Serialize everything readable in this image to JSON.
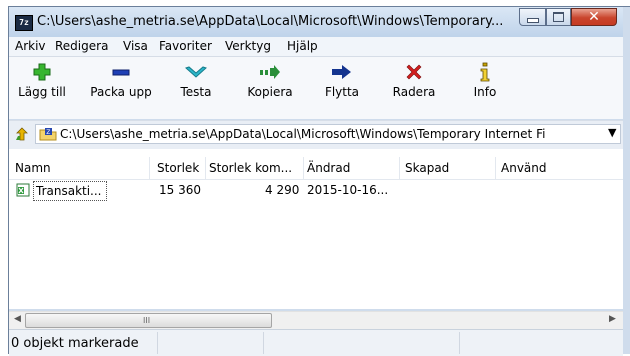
{
  "window": {
    "title": "C:\\Users\\ashe_metria.se\\AppData\\Local\\Microsoft\\Windows\\Temporary...",
    "icon_text": "7z"
  },
  "menu": [
    "Arkiv",
    "Redigera",
    "Visa",
    "Favoriter",
    "Verktyg",
    "Hjälp"
  ],
  "toolbar": [
    {
      "label": "Lägg till",
      "icon": "add-icon",
      "color": "#2fae2a"
    },
    {
      "label": "Packa upp",
      "icon": "extract-icon",
      "color": "#1e3fb5"
    },
    {
      "label": "Testa",
      "icon": "test-icon",
      "color": "#2bb5c9"
    },
    {
      "label": "Kopiera",
      "icon": "copy-icon",
      "color": "#2a8f3a"
    },
    {
      "label": "Flytta",
      "icon": "move-icon",
      "color": "#14348f"
    },
    {
      "label": "Radera",
      "icon": "delete-icon",
      "color": "#d21f1f"
    },
    {
      "label": "Info",
      "icon": "info-icon",
      "color": "#c9a300"
    }
  ],
  "address": {
    "path": "C:\\Users\\ashe_metria.se\\AppData\\Local\\Microsoft\\Windows\\Temporary Internet Fi"
  },
  "columns": [
    "Namn",
    "Storlek",
    "Storlek kom...",
    "Ändrad",
    "Skapad",
    "Använd"
  ],
  "rows": [
    {
      "name": "Transakti...",
      "size": "15 360",
      "packed": "4 290",
      "modified": "2015-10-16...",
      "created": "",
      "accessed": ""
    }
  ],
  "scrollbar": {
    "grip": "III"
  },
  "status": {
    "text": "0 objekt markerade"
  }
}
